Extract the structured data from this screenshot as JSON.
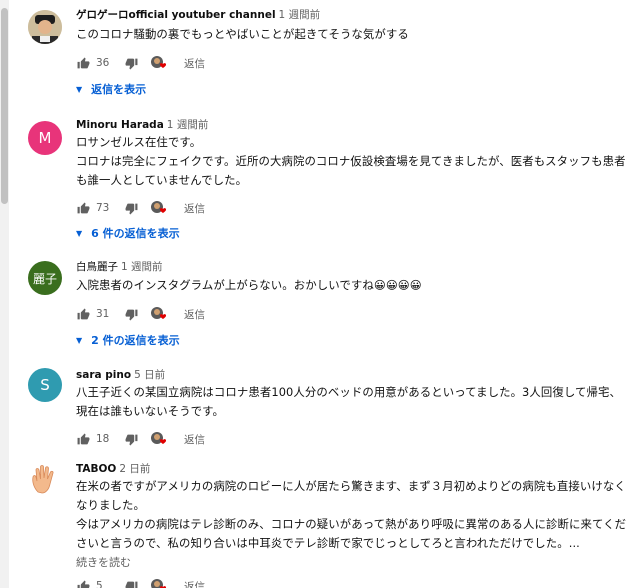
{
  "comments": [
    {
      "author": "ゲロゲーロofficial youtuber channel",
      "time": "1 週間前",
      "lines": [
        "このコロナ騒動の裏でもっとやばいことが起きてそうな気がする"
      ],
      "likes": "36",
      "reply_label": "返信",
      "replies_label": "返信を表示"
    },
    {
      "author": "Minoru Harada",
      "time": "1 週間前",
      "avatar_letter": "M",
      "lines": [
        "ロサンゼルス在住です。",
        "コロナは完全にフェイクです。近所の大病院のコロナ仮設検査場を見てきましたが、医者もスタッフも患者",
        "も誰一人としていませんでした。"
      ],
      "likes": "73",
      "reply_label": "返信",
      "replies_label": "6 件の返信を表示"
    },
    {
      "author": "白鳥麗子",
      "time": "1 週間前",
      "avatar_letter": "麗子",
      "lines": [
        "入院患者のインスタグラムが上がらない。おかしいですね😀😀😀😀"
      ],
      "likes": "31",
      "reply_label": "返信",
      "replies_label": "2 件の返信を表示"
    },
    {
      "author": "sara pino",
      "time": "5 日前",
      "avatar_letter": "S",
      "lines": [
        "八王子近くの某国立病院はコロナ患者100人分のベッドの用意があるといってました。3人回復して帰宅、",
        "現在は誰もいないそうです。"
      ],
      "likes": "18",
      "reply_label": "返信"
    },
    {
      "author": "TABOO",
      "time": "2 日前",
      "lines": [
        "在米の者ですがアメリカの病院のロビーに人が居たら驚きます、まず３月初めよりどの病院も直接いけなく",
        "なりました。",
        "今はアメリカの病院はテレ診断のみ、コロナの疑いがあって熱があり呼吸に異常のある人に診断に来てくだ",
        "さいと言うので、私の知り合いは中耳炎でテレ診断で家でじっとしてろと言われただけでした。..."
      ],
      "read_more": "続きを読む",
      "likes": "5",
      "reply_label": "返信"
    }
  ],
  "colors": {
    "link_blue": "#065fd4",
    "avatar_m": "#e8347a",
    "avatar_reiko": "#3a6e1e",
    "avatar_s": "#2f9bb0",
    "heart_red": "#e00000"
  }
}
